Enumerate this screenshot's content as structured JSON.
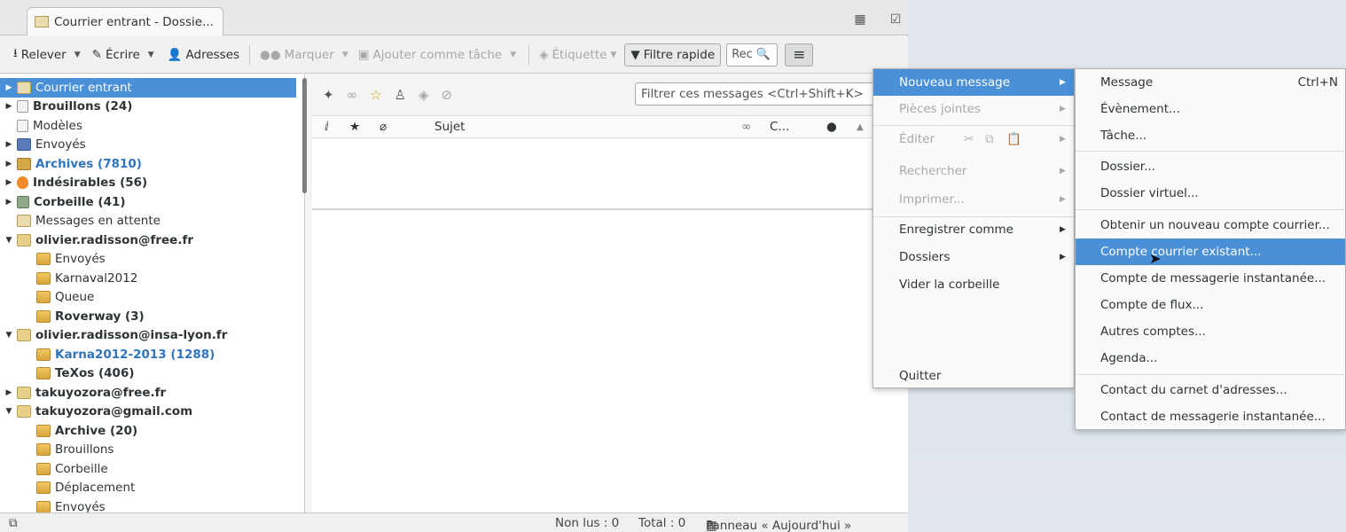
{
  "tab": {
    "label": "Courrier entrant - Dossie..."
  },
  "toolbar": {
    "relever": "Relever",
    "ecrire": "Écrire",
    "adresses": "Adresses",
    "marquer": "Marquer",
    "ajouter_tache": "Ajouter comme tâche",
    "etiquette": "Étiquette",
    "filtre_rapide": "Filtre rapide",
    "search_placeholder": "Rec"
  },
  "folders": [
    {
      "label": "Courrier entrant",
      "style": "normal",
      "selected": true,
      "twisty": "▶",
      "indent": 0,
      "icon": "inbox"
    },
    {
      "label": "Brouillons (24)",
      "style": "bold",
      "twisty": "▶",
      "indent": 0,
      "icon": "doc"
    },
    {
      "label": "Modèles",
      "style": "normal",
      "twisty": "",
      "indent": 0,
      "icon": "doc"
    },
    {
      "label": "Envoyés",
      "style": "normal",
      "twisty": "▶",
      "indent": 0,
      "icon": "sent"
    },
    {
      "label": "Archives (7810)",
      "style": "link",
      "twisty": "▶",
      "indent": 0,
      "icon": "arch"
    },
    {
      "label": "Indésirables (56)",
      "style": "bold",
      "twisty": "▶",
      "indent": 0,
      "icon": "junk"
    },
    {
      "label": "Corbeille (41)",
      "style": "bold",
      "twisty": "▶",
      "indent": 0,
      "icon": "trash"
    },
    {
      "label": "Messages en attente",
      "style": "normal",
      "twisty": "",
      "indent": 0,
      "icon": "inbox"
    },
    {
      "label": "olivier.radisson@free.fr",
      "style": "bold",
      "twisty": "▼",
      "indent": 0,
      "icon": "acct"
    },
    {
      "label": "Envoyés",
      "style": "normal",
      "twisty": "",
      "indent": 1,
      "icon": "folder"
    },
    {
      "label": "Karnaval2012",
      "style": "normal",
      "twisty": "",
      "indent": 1,
      "icon": "folder"
    },
    {
      "label": "Queue",
      "style": "normal",
      "twisty": "",
      "indent": 1,
      "icon": "folder"
    },
    {
      "label": "Roverway (3)",
      "style": "bold",
      "twisty": "",
      "indent": 1,
      "icon": "folder"
    },
    {
      "label": "olivier.radisson@insa-lyon.fr",
      "style": "bold",
      "twisty": "▼",
      "indent": 0,
      "icon": "acct"
    },
    {
      "label": "Karna2012-2013 (1288)",
      "style": "link",
      "twisty": "",
      "indent": 1,
      "icon": "folder"
    },
    {
      "label": "TeXos (406)",
      "style": "bold",
      "twisty": "",
      "indent": 1,
      "icon": "folder"
    },
    {
      "label": "takuyozora@free.fr",
      "style": "bold",
      "twisty": "▶",
      "indent": 0,
      "icon": "acct"
    },
    {
      "label": "takuyozora@gmail.com",
      "style": "bold",
      "twisty": "▼",
      "indent": 0,
      "icon": "acct"
    },
    {
      "label": "Archive (20)",
      "style": "bold",
      "twisty": "",
      "indent": 1,
      "icon": "folder"
    },
    {
      "label": "Brouillons",
      "style": "normal",
      "twisty": "",
      "indent": 1,
      "icon": "folder"
    },
    {
      "label": "Corbeille",
      "style": "normal",
      "twisty": "",
      "indent": 1,
      "icon": "folder"
    },
    {
      "label": "Déplacement",
      "style": "normal",
      "twisty": "",
      "indent": 1,
      "icon": "folder"
    },
    {
      "label": "Envoyés",
      "style": "normal",
      "twisty": "",
      "indent": 1,
      "icon": "folder"
    }
  ],
  "message_pane": {
    "filter_placeholder": "Filtrer ces messages <Ctrl+Shift+K>",
    "columns": {
      "subject": "Sujet",
      "correspondent": "C..."
    }
  },
  "status": {
    "unread": "Non lus : 0",
    "total": "Total : 0",
    "today_pane": "Panneau « Aujourd'hui »",
    "today_arrow": "⌃"
  },
  "main_menu": [
    {
      "label": "Nouveau message",
      "active": true,
      "arrow": true
    },
    {
      "label": "Pièces jointes",
      "disabled": true,
      "arrow": true
    },
    {
      "label": "Éditer",
      "disabled": true,
      "arrow": true
    },
    {
      "label": "Rechercher",
      "disabled": true,
      "arrow": true
    },
    {
      "label": "Imprimer...",
      "disabled": true,
      "arrow": true
    },
    {
      "label": "Enregistrer comme",
      "arrow": true
    },
    {
      "label": "Dossiers",
      "arrow": true
    },
    {
      "label": "Vider la corbeille"
    },
    {
      "label": "Quitter"
    }
  ],
  "sub_menu": [
    {
      "label": "Message",
      "shortcut": "Ctrl+N"
    },
    {
      "label": "Évènement..."
    },
    {
      "label": "Tâche..."
    },
    {
      "label": "Dossier..."
    },
    {
      "label": "Dossier virtuel..."
    },
    {
      "label": "Obtenir un nouveau compte courrier..."
    },
    {
      "label": "Compte courrier existant...",
      "active": true
    },
    {
      "label": "Compte de messagerie instantanée..."
    },
    {
      "label": "Compte de flux..."
    },
    {
      "label": "Autres comptes..."
    },
    {
      "label": "Agenda..."
    },
    {
      "label": "Contact du carnet d'adresses..."
    },
    {
      "label": "Contact de messagerie instantanée..."
    }
  ],
  "colors": {
    "accent": "#4a90d9",
    "link": "#2f74c0"
  }
}
